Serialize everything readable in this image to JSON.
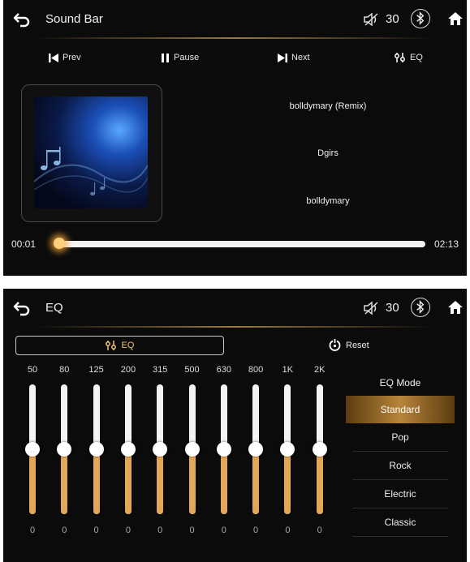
{
  "player": {
    "header": {
      "back_icon": "back-arrow-icon",
      "title": "Sound Bar",
      "mute_icon": "speaker-muted-icon",
      "volume": "30",
      "bluetooth_icon": "bluetooth-icon",
      "home_icon": "home-icon"
    },
    "controls": [
      {
        "name": "prev",
        "icon": "skip-previous-icon",
        "label": "Prev"
      },
      {
        "name": "pause",
        "icon": "pause-icon",
        "label": "Pause"
      },
      {
        "name": "next",
        "icon": "skip-next-icon",
        "label": "Next"
      },
      {
        "name": "eq",
        "icon": "equalizer-icon",
        "label": "EQ"
      }
    ],
    "track": {
      "title": "bolldymary (Remix)",
      "artist": "Dgirs",
      "album": "bolldymary"
    },
    "progress": {
      "elapsed": "00:01",
      "total": "02:13",
      "fraction": 0.01
    }
  },
  "eq": {
    "header": {
      "back_icon": "back-arrow-icon",
      "title": "EQ",
      "mute_icon": "speaker-muted-icon",
      "volume": "30",
      "bluetooth_icon": "bluetooth-icon",
      "home_icon": "home-icon"
    },
    "eq_button": {
      "icon": "equalizer-icon",
      "label": "EQ"
    },
    "reset": {
      "icon": "reset-icon",
      "label": "Reset"
    },
    "bands": [
      {
        "freq": "50",
        "gain": "0",
        "level": 0.5
      },
      {
        "freq": "80",
        "gain": "0",
        "level": 0.5
      },
      {
        "freq": "125",
        "gain": "0",
        "level": 0.5
      },
      {
        "freq": "200",
        "gain": "0",
        "level": 0.5
      },
      {
        "freq": "315",
        "gain": "0",
        "level": 0.5
      },
      {
        "freq": "500",
        "gain": "0",
        "level": 0.5
      },
      {
        "freq": "630",
        "gain": "0",
        "level": 0.5
      },
      {
        "freq": "800",
        "gain": "0",
        "level": 0.5
      },
      {
        "freq": "1K",
        "gain": "0",
        "level": 0.5
      },
      {
        "freq": "2K",
        "gain": "0",
        "level": 0.5
      }
    ],
    "modes": {
      "title": "EQ Mode",
      "items": [
        "Standard",
        "Pop",
        "Rock",
        "Electric",
        "Classic"
      ],
      "selected": "Standard"
    }
  },
  "colors": {
    "accent": "#e3a759",
    "background": "#0b0b0b",
    "track_fill": "#f4f4f4"
  }
}
